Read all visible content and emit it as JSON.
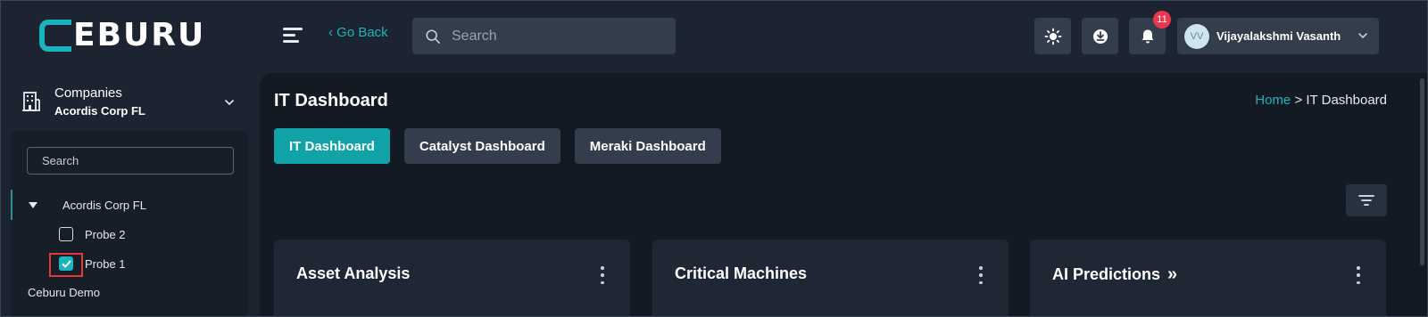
{
  "header": {
    "logo_text": "EBURU",
    "go_back_label": "‹ Go Back",
    "search_placeholder": "Search",
    "notification_count": "11",
    "user": {
      "initials": "VV",
      "name": "Vijayalakshmi Vasanth"
    },
    "icons": [
      "menu-icon",
      "search-icon",
      "theme-sun-icon",
      "download-icon",
      "bell-icon",
      "chevron-down-icon"
    ]
  },
  "sidebar": {
    "company_label": "Companies",
    "company_value": "Acordis Corp FL",
    "search_placeholder": "Search",
    "tree": {
      "root": "Acordis Corp FL",
      "children": [
        {
          "label": "Probe 2",
          "checked": false
        },
        {
          "label": "Probe 1",
          "checked": true
        }
      ],
      "next_company": "Ceburu Demo"
    }
  },
  "main": {
    "title": "IT Dashboard",
    "breadcrumb": {
      "home": "Home",
      "separator": ">",
      "current": "IT Dashboard"
    },
    "tabs": [
      {
        "label": "IT Dashboard",
        "active": true
      },
      {
        "label": "Catalyst Dashboard",
        "active": false
      },
      {
        "label": "Meraki Dashboard",
        "active": false
      }
    ],
    "cards": [
      {
        "title": "Asset Analysis"
      },
      {
        "title": "Critical Machines"
      },
      {
        "title": "AI Predictions",
        "suffix": "»"
      }
    ]
  },
  "colors": {
    "accent": "#19b5bd",
    "background": "#1b2430",
    "main_background": "#131a24",
    "card_background": "#1e2733",
    "badge": "#e8384f",
    "highlight": "#e53935"
  }
}
